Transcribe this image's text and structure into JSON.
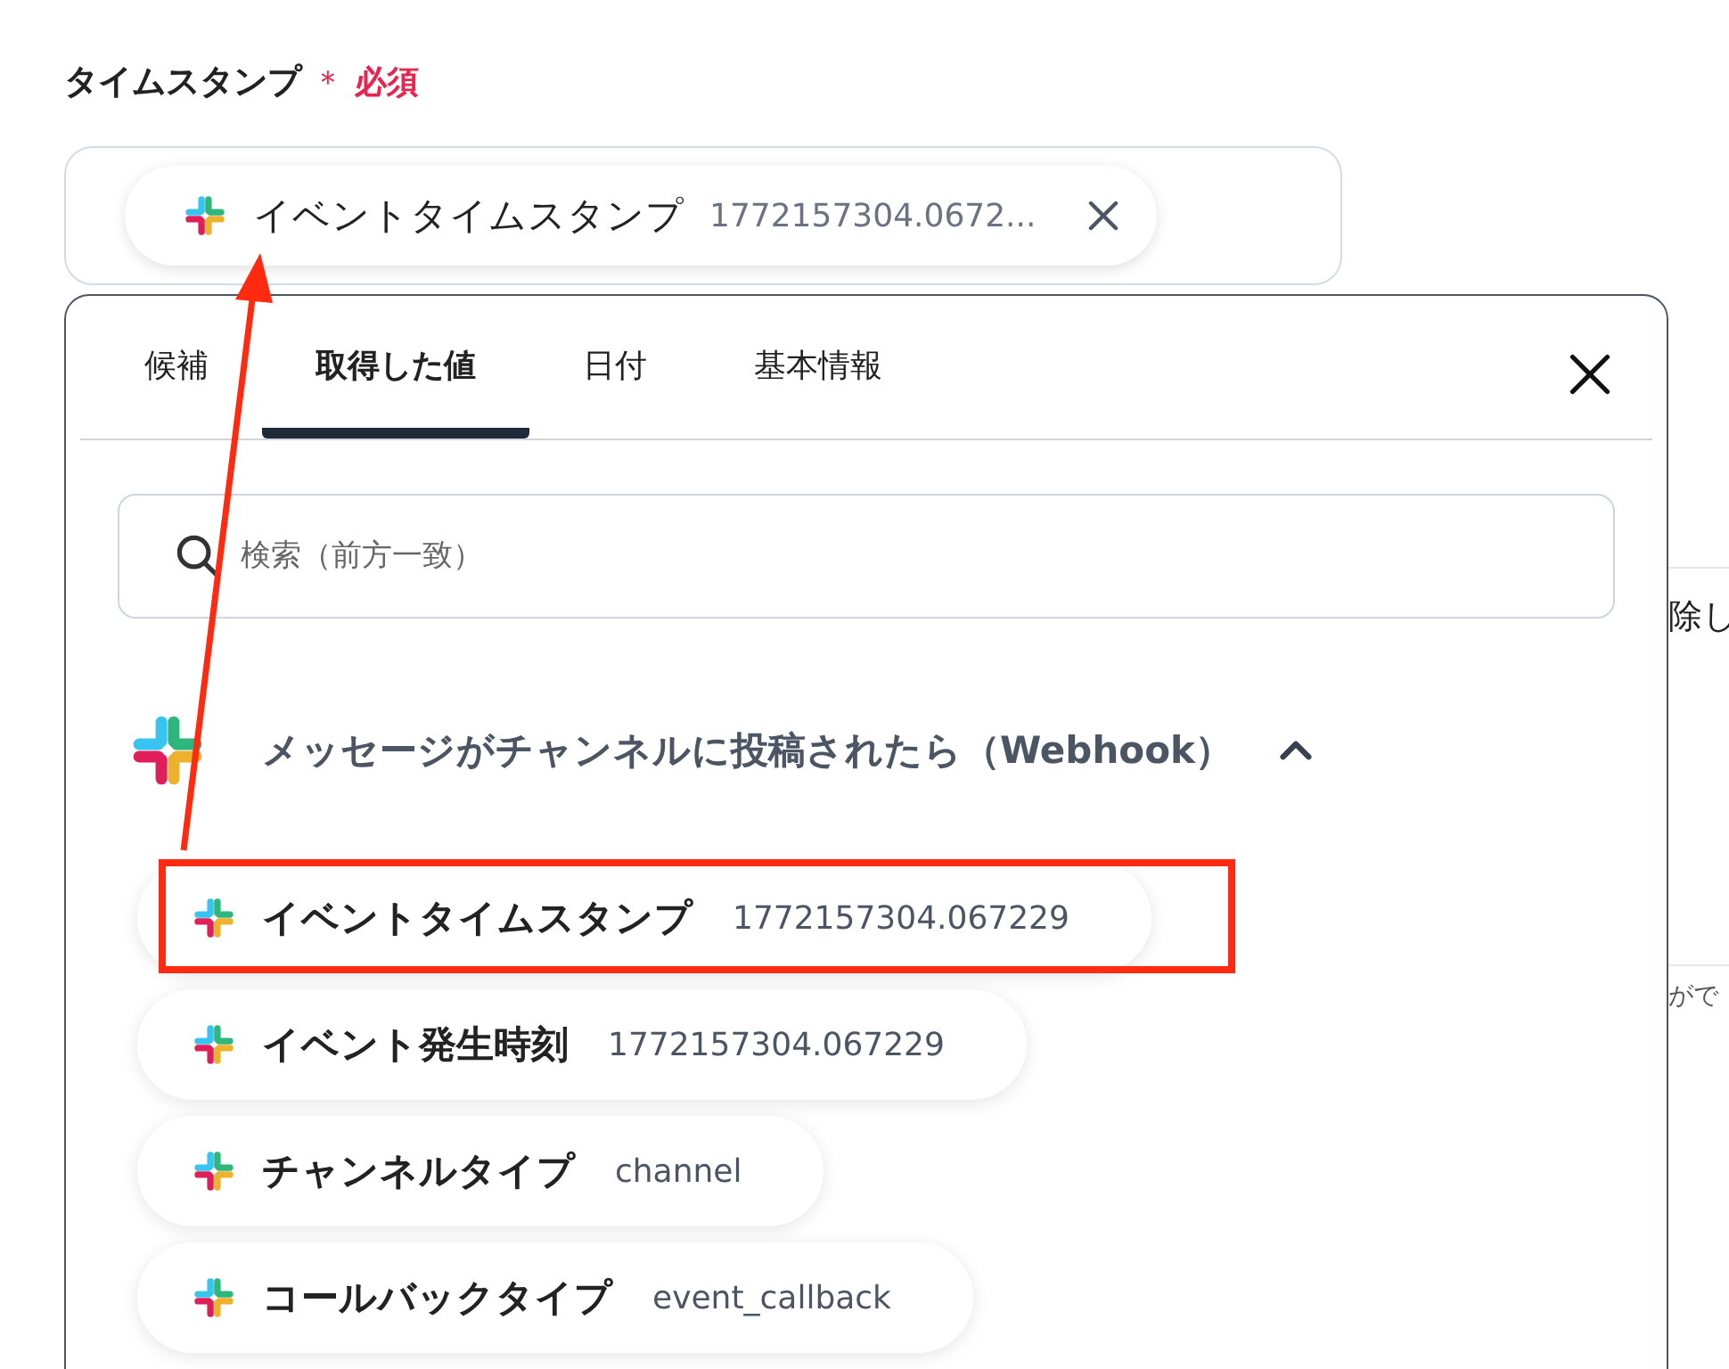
{
  "field": {
    "label": "タイムスタンプ",
    "required_mark": "＊",
    "required_text": "必須",
    "chip": {
      "name": "イベントタイムスタンプ",
      "value": "1772157304.0672..."
    }
  },
  "background_texts": [
    "除し",
    "がで"
  ],
  "popup": {
    "tabs": [
      {
        "label": "候補",
        "selected": false
      },
      {
        "label": "取得した値",
        "selected": true
      },
      {
        "label": "日付",
        "selected": false
      },
      {
        "label": "基本情報",
        "selected": false
      }
    ],
    "search": {
      "placeholder": "検索（前方一致）"
    },
    "group": {
      "title": "メッセージがチャンネルに投稿されたら（Webhook）",
      "expanded": true
    },
    "items": [
      {
        "name": "イベントタイムスタンプ",
        "value": "1772157304.067229",
        "highlighted": true
      },
      {
        "name": "イベント発生時刻",
        "value": "1772157304.067229",
        "highlighted": false
      },
      {
        "name": "チャンネルタイプ",
        "value": "channel",
        "highlighted": false
      },
      {
        "name": "コールバックタイプ",
        "value": "event_callback",
        "highlighted": false
      }
    ]
  }
}
